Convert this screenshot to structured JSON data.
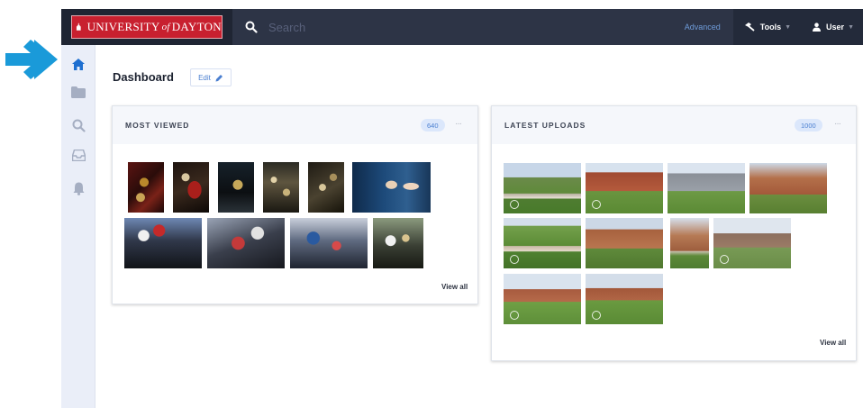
{
  "brand": {
    "logo_prefix": "UNIVERSITY",
    "logo_of": "of",
    "logo_suffix": "DAYTON",
    "accent_color": "#c8202f",
    "nav_color": "#2d3446"
  },
  "search": {
    "placeholder": "Search",
    "advanced_label": "Advanced"
  },
  "header_menu": {
    "tools_label": "Tools",
    "user_label": "User"
  },
  "sidebar": {
    "items": [
      {
        "name": "home-icon",
        "active": true
      },
      {
        "name": "folder-icon",
        "active": false
      },
      {
        "name": "search-icon",
        "active": false
      },
      {
        "name": "inbox-icon",
        "active": false
      },
      {
        "name": "bell-icon",
        "active": false
      }
    ]
  },
  "dashboard": {
    "title": "Dashboard",
    "edit_label": "Edit"
  },
  "most_viewed": {
    "title": "MOST VIEWED",
    "count": "640",
    "more": "···",
    "view_all": "View all"
  },
  "latest_uploads": {
    "title": "LATEST UPLOADS",
    "count": "1000",
    "more": "···",
    "view_all": "View all"
  }
}
